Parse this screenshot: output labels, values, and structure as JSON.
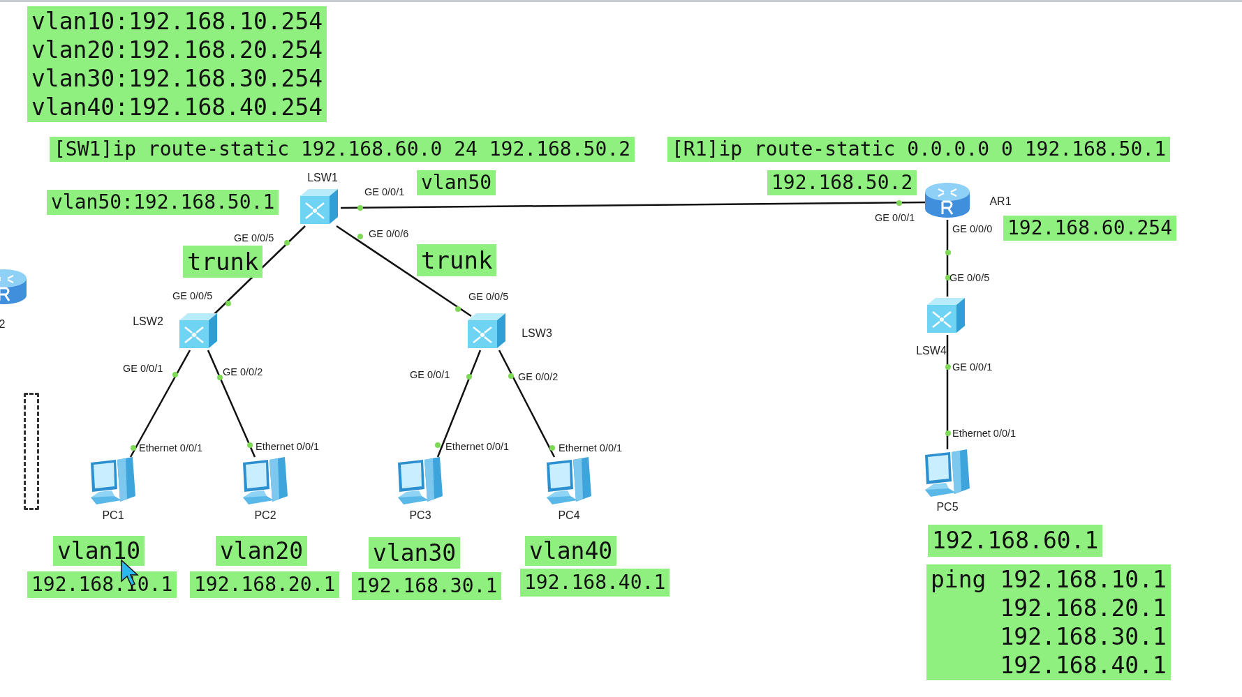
{
  "annotations": [
    {
      "kind": "note",
      "lines": [
        "vlan10:192.168.10.254",
        "vlan20:192.168.20.254",
        "vlan30:192.168.30.254",
        "vlan40:192.168.40.254"
      ]
    },
    {
      "kind": "note",
      "lines": [
        "[SW1]ip route-static 192.168.60.0 24 192.168.50.2"
      ]
    },
    {
      "kind": "note",
      "lines": [
        "[R1]ip route-static 0.0.0.0 0 192.168.50.1"
      ]
    },
    {
      "kind": "note",
      "lines": [
        "vlan50:192.168.50.1"
      ]
    },
    {
      "kind": "note",
      "lines": [
        "vlan50"
      ]
    },
    {
      "kind": "note",
      "lines": [
        "192.168.50.2"
      ]
    },
    {
      "kind": "note",
      "lines": [
        "192.168.60.254"
      ]
    },
    {
      "kind": "note",
      "lines": [
        "trunk"
      ]
    },
    {
      "kind": "note",
      "lines": [
        "trunk"
      ]
    },
    {
      "kind": "note",
      "lines": [
        "vlan10"
      ]
    },
    {
      "kind": "note",
      "lines": [
        "vlan20"
      ]
    },
    {
      "kind": "note",
      "lines": [
        "vlan30"
      ]
    },
    {
      "kind": "note",
      "lines": [
        "vlan40"
      ]
    },
    {
      "kind": "note",
      "lines": [
        "192.168.10.1"
      ]
    },
    {
      "kind": "note",
      "lines": [
        "192.168.20.1"
      ]
    },
    {
      "kind": "note",
      "lines": [
        "192.168.30.1"
      ]
    },
    {
      "kind": "note",
      "lines": [
        "192.168.40.1"
      ]
    },
    {
      "kind": "note",
      "lines": [
        "192.168.60.1"
      ]
    },
    {
      "kind": "ping",
      "command": "ping",
      "targets": [
        "192.168.10.1",
        "192.168.20.1",
        "192.168.30.1",
        "192.168.40.1"
      ]
    }
  ],
  "devices": [
    {
      "name": "LSW1",
      "kind": "switch"
    },
    {
      "name": "LSW2",
      "kind": "switch"
    },
    {
      "name": "LSW3",
      "kind": "switch"
    },
    {
      "name": "AR1",
      "kind": "router"
    },
    {
      "name": "LSW4",
      "kind": "switch"
    },
    {
      "name": "PC1",
      "kind": "pc"
    },
    {
      "name": "PC2",
      "kind": "pc"
    },
    {
      "name": "PC3",
      "kind": "pc"
    },
    {
      "name": "PC4",
      "kind": "pc"
    },
    {
      "name": "PC5",
      "kind": "pc"
    },
    {
      "name": "2",
      "kind": "router"
    }
  ],
  "ports": [
    "GE 0/0/1",
    "GE 0/0/5",
    "GE 0/0/6",
    "GE 0/0/1",
    "GE 0/0/0",
    "GE 0/0/5",
    "GE 0/0/5",
    "GE 0/0/5",
    "GE 0/0/1",
    "GE 0/0/2",
    "GE 0/0/1",
    "GE 0/0/2",
    "GE 0/0/1",
    "Ethernet 0/0/1",
    "Ethernet 0/0/1",
    "Ethernet 0/0/1",
    "Ethernet 0/0/1",
    "Ethernet 0/0/1"
  ]
}
